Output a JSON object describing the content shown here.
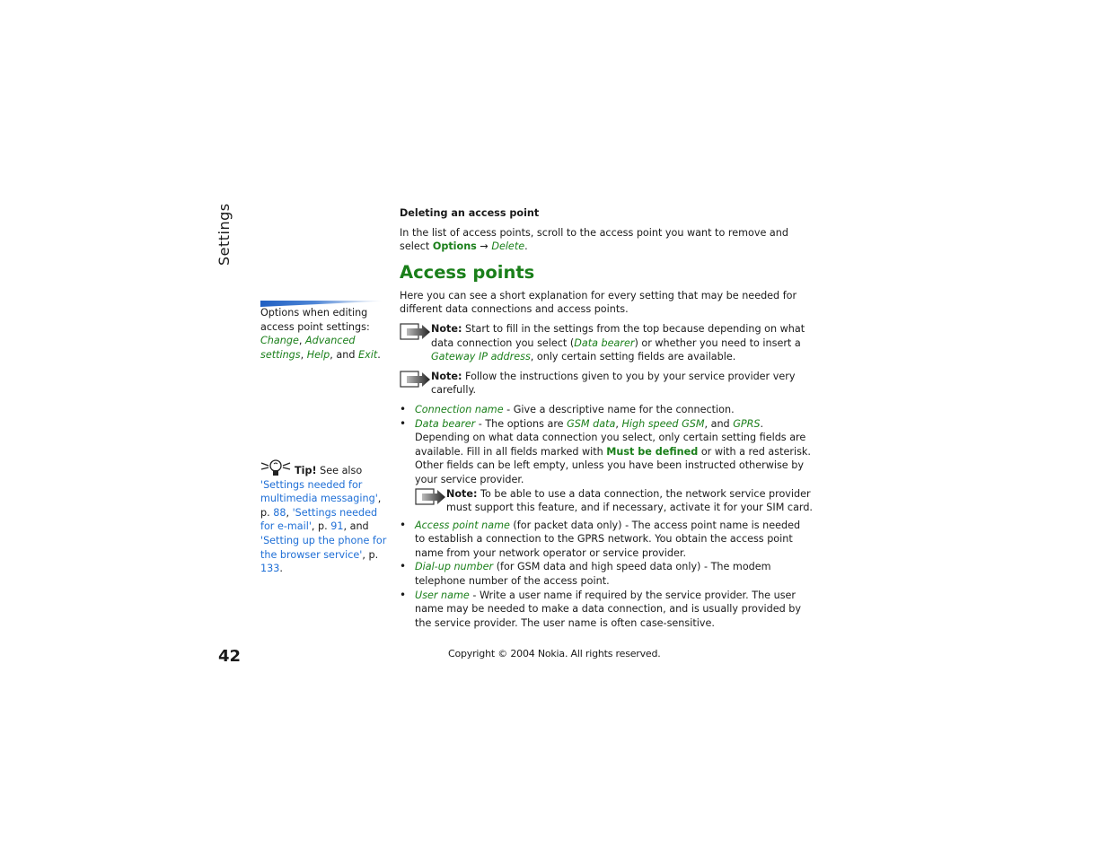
{
  "section_tab": "Settings",
  "sidebar": {
    "options_intro": "Options when editing access point settings:",
    "options": [
      "Change",
      "Advanced settings",
      "Help",
      "Exit"
    ],
    "options_and": "and",
    "tip": {
      "label": "Tip!",
      "see_also": "See also",
      "ref1": "'Settings needed for multimedia messaging'",
      "ref1_page_prefix": ", p.",
      "ref1_page": "88",
      "ref2": "'Settings needed for e-mail'",
      "ref2_page_prefix": ", p.",
      "ref2_page": "91",
      "and": ", and",
      "ref3": "'Setting up the phone for the browser service'",
      "ref3_page_prefix": ", p.",
      "ref3_page": "133"
    }
  },
  "main": {
    "delete_heading": "Deleting an access point",
    "delete_text": "In the list of access points, scroll to the access point you want to remove and select",
    "delete_menu": "Options",
    "delete_arrow": "→",
    "delete_item": "Delete",
    "title": "Access points",
    "intro": "Here you can see a short explanation for every setting that may be needed for different data connections and access points.",
    "note1": {
      "label": "Note:",
      "text_a": "Start to fill in the settings from the top because depending on what data connection you select (",
      "term1": "Data bearer",
      "text_b": ") or whether you need to insert a",
      "term2": "Gateway IP address",
      "text_c": ", only certain setting fields are available."
    },
    "note2": {
      "label": "Note:",
      "text": "Follow the instructions given to you by your service provider very carefully."
    },
    "bullets": [
      {
        "term": "Connection name",
        "text": " - Give a descriptive name for the connection."
      },
      {
        "term": "Data bearer",
        "text_a": " - The options are",
        "opt1": "GSM data",
        "opt2": "High speed GSM",
        "and": ", and",
        "opt3": "GPRS",
        "text_b": ". Depending on what data connection you select, only certain setting fields are available. Fill in all fields marked with",
        "must": "Must be defined",
        "text_c": "or with a red asterisk. Other fields can be left empty, unless you have been instructed otherwise by your service provider.",
        "note_label": "Note:",
        "note_text": "To be able to use a data connection, the network service provider must support this feature, and if necessary, activate it for your SIM card."
      },
      {
        "term": "Access point name",
        "text": " (for packet data only) - The access point name is needed to establish a connection to the GPRS network. You obtain the access point name from your network operator or service provider."
      },
      {
        "term": "Dial-up number",
        "text": " (for GSM data and high speed data only) - The modem telephone number of the access point."
      },
      {
        "term": "User name",
        "text": " - Write a user name if required by the service provider. The user name may be needed to make a data connection, and is usually provided by the service provider. The user name is often case-sensitive."
      }
    ]
  },
  "footer": {
    "page_number": "42",
    "copyright": "Copyright © 2004 Nokia. All rights reserved."
  },
  "colors": {
    "term_green": "#1a7f1a",
    "link_blue": "#1f6fd6",
    "sidebar_bar_blue": "#1f5fc2"
  }
}
